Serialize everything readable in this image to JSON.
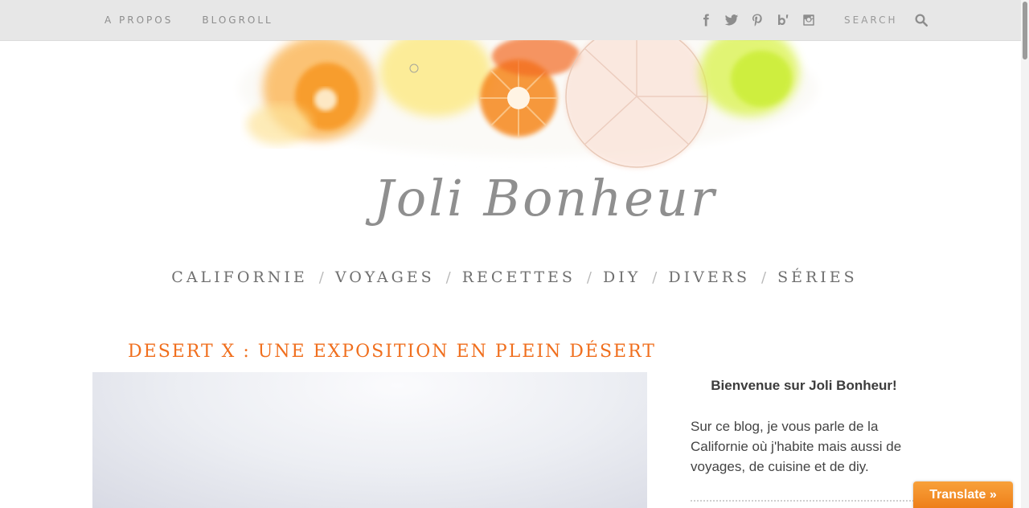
{
  "topbar": {
    "links": [
      "A PROPOS",
      "BLOGROLL"
    ],
    "social_icons": [
      "facebook-icon",
      "twitter-icon",
      "pinterest-icon",
      "bloglovin-icon",
      "instagram-icon"
    ],
    "search": {
      "placeholder": "SEARCH",
      "icon": "search-icon"
    }
  },
  "header": {
    "logo_text": "Joli Bonheur"
  },
  "mainnav": {
    "items": [
      "CALIFORNIE",
      "VOYAGES",
      "RECETTES",
      "DIY",
      "DIVERS",
      "SÉRIES"
    ],
    "separator": "/"
  },
  "post": {
    "title": "DESERT X : UNE EXPOSITION EN PLEIN DÉSERT"
  },
  "sidebar": {
    "title": "Bienvenue sur Joli Bonheur!",
    "text": "Sur ce blog, je vous parle de la Californie où j'habite mais aussi de voyages, de cuisine et de diy."
  },
  "translate": {
    "label": "Translate »"
  },
  "colors": {
    "accent": "#f06f1e",
    "topbar_bg": "#e7e7e7",
    "translate_bg": "#f39223"
  }
}
